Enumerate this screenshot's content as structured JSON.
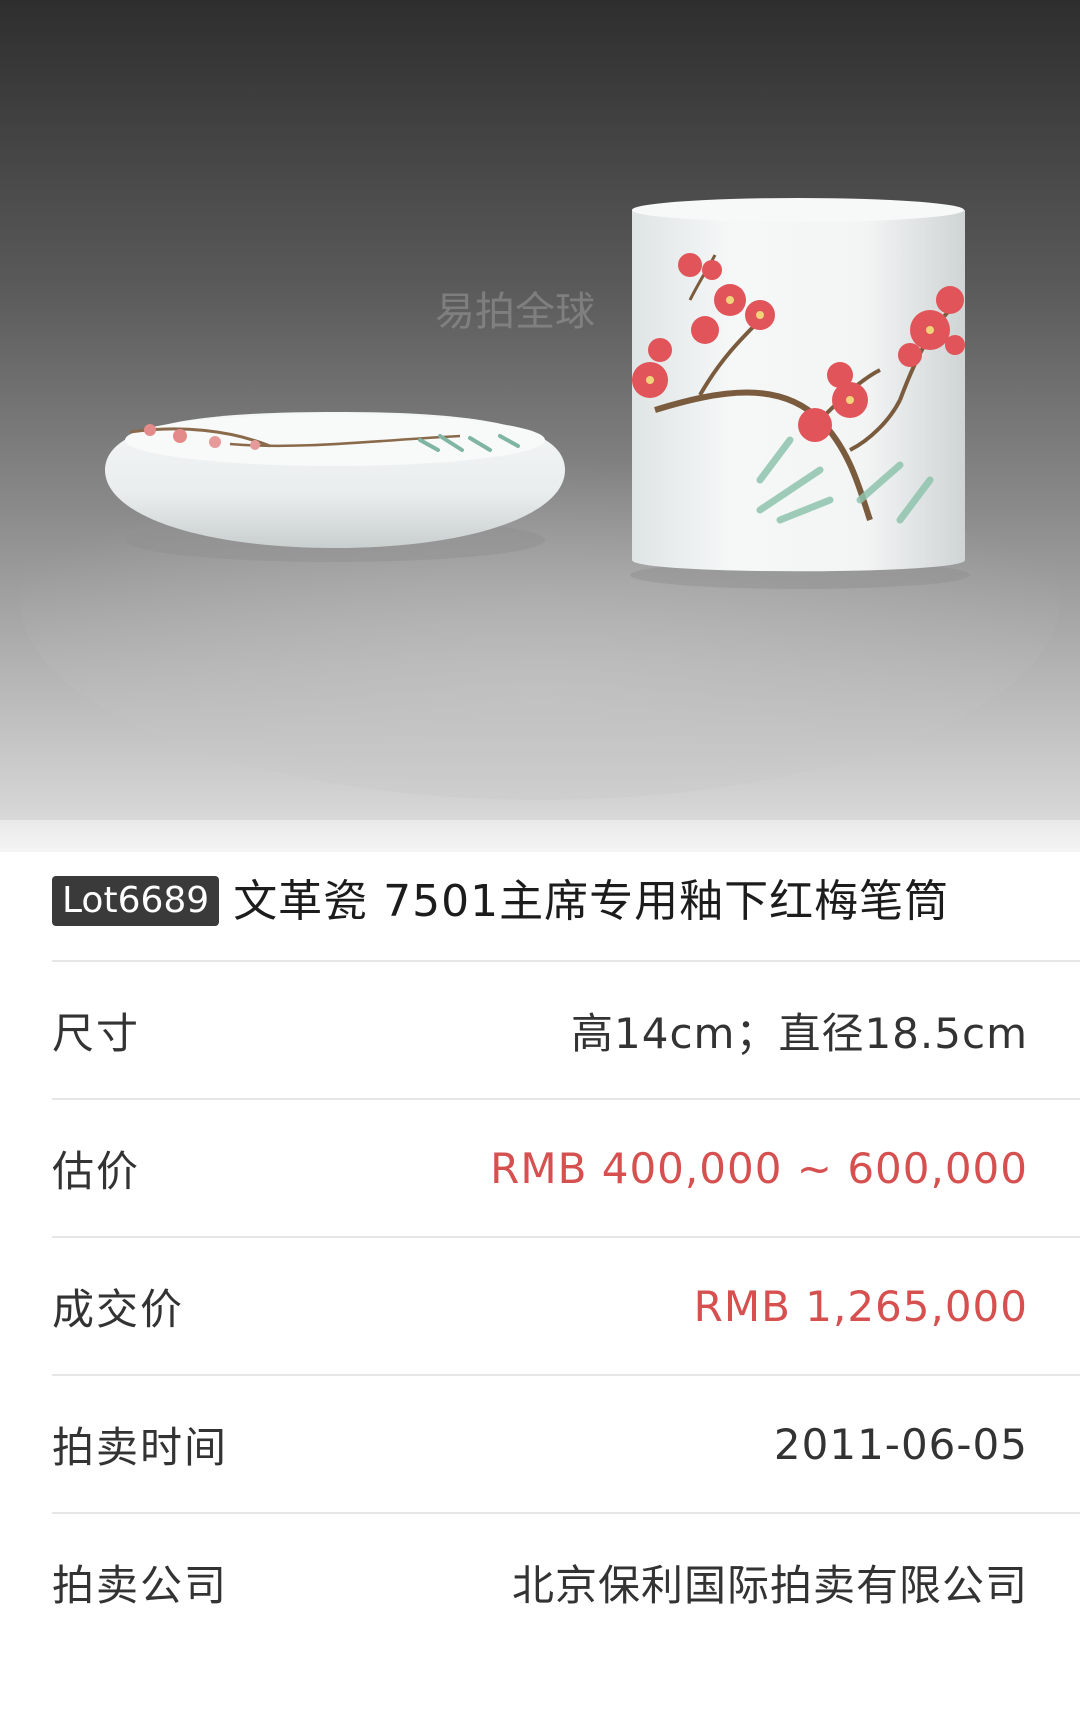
{
  "photo": {
    "description_icon": "porcelain-image"
  },
  "lot": {
    "badge": "Lot6689",
    "title": "文革瓷 7501主席专用釉下红梅笔筒"
  },
  "details": [
    {
      "label": "尺寸",
      "value": "高14cm；直径18.5cm",
      "accent": false
    },
    {
      "label": "估价",
      "value": "RMB 400,000 ~ 600,000",
      "accent": true
    },
    {
      "label": "成交价",
      "value": "RMB 1,265,000",
      "accent": true
    },
    {
      "label": "拍卖时间",
      "value": "2011-06-05",
      "accent": false
    },
    {
      "label": "拍卖公司",
      "value": "北京保利国际拍卖有限公司",
      "accent": false
    }
  ],
  "colors": {
    "accent": "#d65050",
    "text": "#333333",
    "badge_bg": "#3a3a3a"
  }
}
